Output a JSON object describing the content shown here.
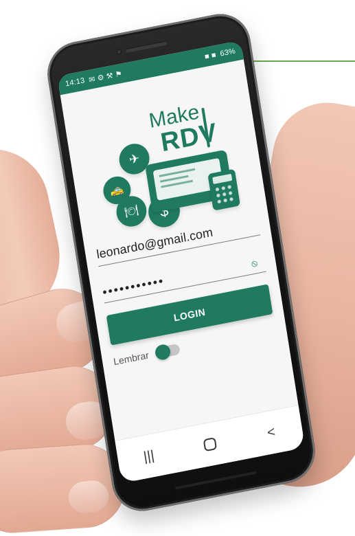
{
  "status_bar": {
    "time": "14:13",
    "left_icons": "✉ ⚙ ⚒ ⚑",
    "right_text": "63%",
    "right_icons": "■ ■"
  },
  "logo": {
    "make": "Make",
    "rdv": "RDV"
  },
  "login": {
    "email": "leonardo@gmail.com",
    "password_mask": "•••••••••••",
    "button_label": "LOGIN",
    "remember_label": "Lembrar"
  },
  "nav": {
    "recent": "|||",
    "back": "<"
  },
  "colors": {
    "primary": "#1f7a5f",
    "top_line": "#6aa84f"
  },
  "icons": {
    "eye": "eye-off-icon",
    "plane": "plane-icon",
    "taxi": "taxi-icon",
    "dish": "dish-icon",
    "dollar": "dollar-icon",
    "laptop": "laptop-icon",
    "calculator": "calculator-icon"
  }
}
